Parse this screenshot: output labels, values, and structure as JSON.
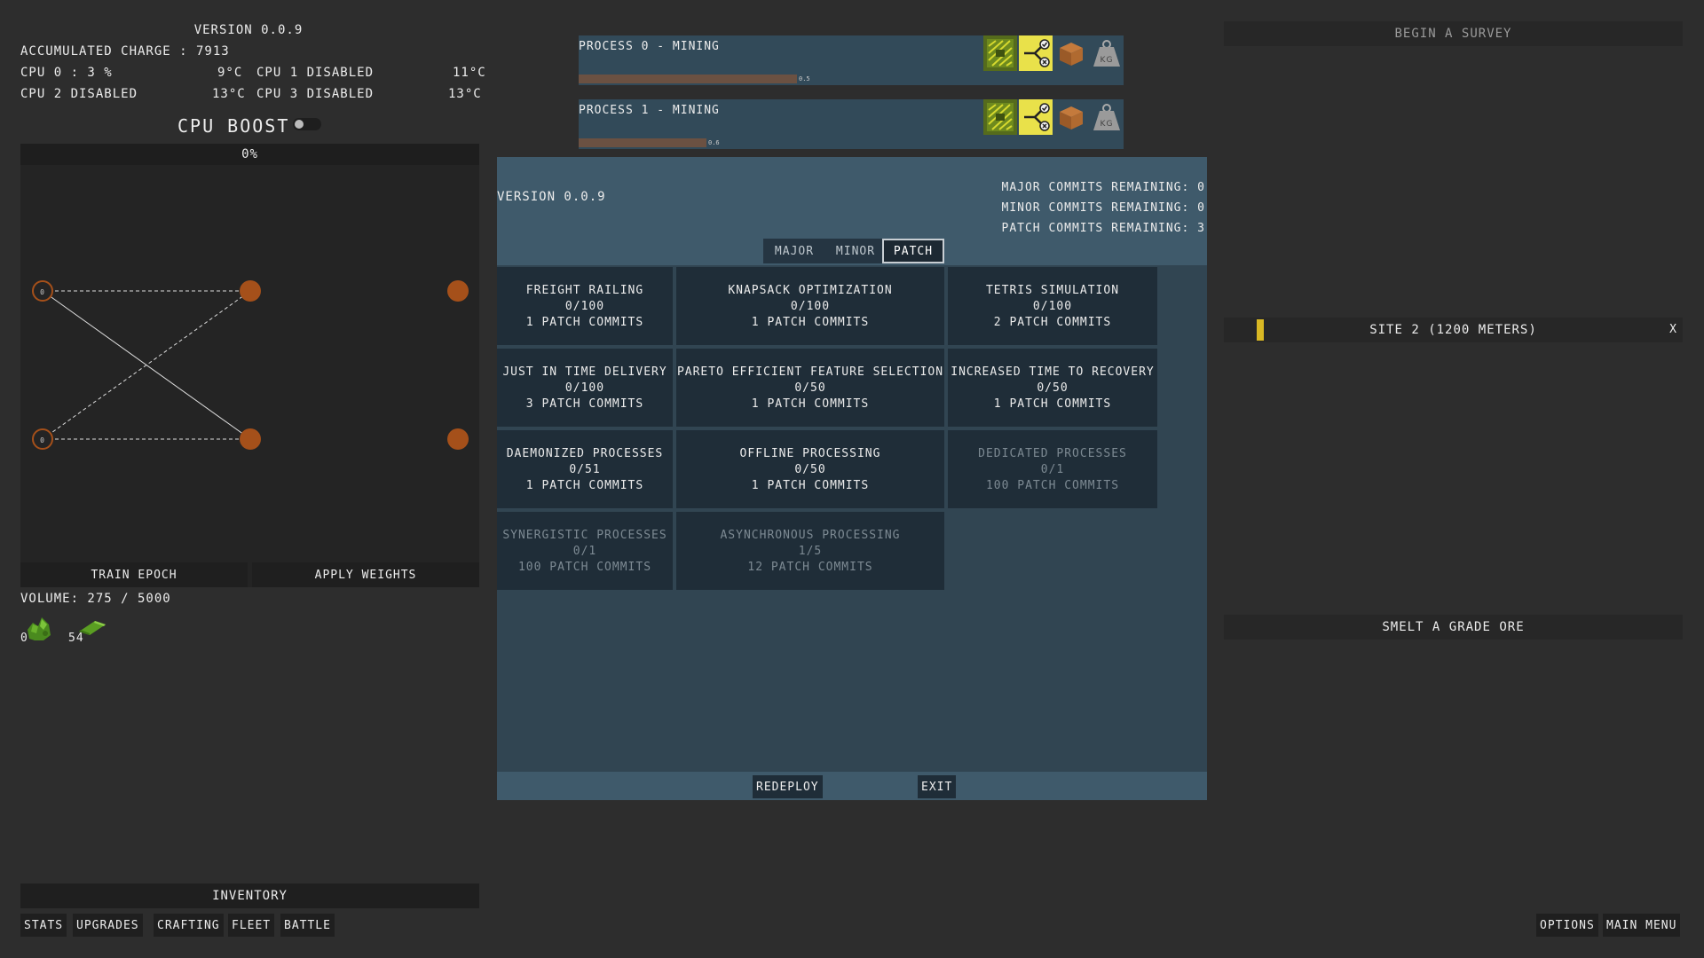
{
  "left": {
    "version": "version 0.0.9",
    "charge": "accumulated charge : 7913",
    "cpus": [
      {
        "label": "cpu 0 : 3 %",
        "temp": "9°c"
      },
      {
        "label": "cpu 1 disabled",
        "temp": "11°c"
      },
      {
        "label": "cpu 2 disabled",
        "temp": "13°c"
      },
      {
        "label": "cpu 3 disabled",
        "temp": "13°c"
      }
    ],
    "cpu_boost": "cpu boost",
    "nn_percent": "0%",
    "node_labels": [
      "0",
      "0"
    ],
    "train_epoch": "train epoch",
    "apply_weights": "apply weights",
    "volume": "volume: 275 / 5000",
    "resources": [
      {
        "count": "0",
        "icon": "ore-pile-icon"
      },
      {
        "count": "54",
        "icon": "bar-ingot-icon"
      }
    ]
  },
  "processes": [
    {
      "title": "process 0 - mining",
      "value": "0.5",
      "progress": 0.41
    },
    {
      "title": "process 1 - mining",
      "value": "0.6",
      "progress": 0.24
    }
  ],
  "version_panel": {
    "version": "version 0.0.9",
    "major_remaining": "major commits remaining: 0",
    "minor_remaining": "minor commits remaining: 0",
    "patch_remaining": "patch commits remaining: 3",
    "tabs": [
      "major",
      "minor",
      "patch"
    ],
    "active_tab": "patch",
    "upgrades": [
      {
        "name": "freight railing",
        "progress": "0/100",
        "cost": "1 patch commits",
        "disabled": false
      },
      {
        "name": "knapsack optimization",
        "progress": "0/100",
        "cost": "1 patch commits",
        "disabled": false
      },
      {
        "name": "tetris simulation",
        "progress": "0/100",
        "cost": "2 patch commits",
        "disabled": false
      },
      {
        "name": "just in time delivery",
        "progress": "0/100",
        "cost": "3 patch commits",
        "disabled": false
      },
      {
        "name": "pareto efficient feature selection",
        "progress": "0/50",
        "cost": "1 patch commits",
        "disabled": false
      },
      {
        "name": "increased time to recovery",
        "progress": "0/50",
        "cost": "1 patch commits",
        "disabled": false
      },
      {
        "name": "daemonized processes",
        "progress": "0/51",
        "cost": "1 patch commits",
        "disabled": false
      },
      {
        "name": "offline processing",
        "progress": "0/50",
        "cost": "1 patch commits",
        "disabled": false
      },
      {
        "name": "dedicated processes",
        "progress": "0/1",
        "cost": "100 patch commits",
        "disabled": true
      },
      {
        "name": "synergistic processes",
        "progress": "0/1",
        "cost": "100 patch commits",
        "disabled": true
      },
      {
        "name": "asynchronous processing",
        "progress": "1/5",
        "cost": "12 patch commits",
        "disabled": true
      }
    ],
    "redeploy": "redeploy",
    "exit": "exit"
  },
  "right": {
    "begin_survey": "begin a survey",
    "site": "site 2 (1200 meters)",
    "site_close": "x",
    "smelt": "smelt a grade ore"
  },
  "bottom": {
    "inventory": "inventory",
    "tabs": [
      "stats",
      "upgrades",
      "crafting",
      "fleet",
      "battle"
    ],
    "options": "options",
    "main_menu": "main menu"
  },
  "colors": {
    "background": "#2d2d2d",
    "panel_blue": "#314552",
    "process_fill": "#6b5142",
    "node_orange": "#a5501a",
    "site_marker": "#d9b824"
  }
}
